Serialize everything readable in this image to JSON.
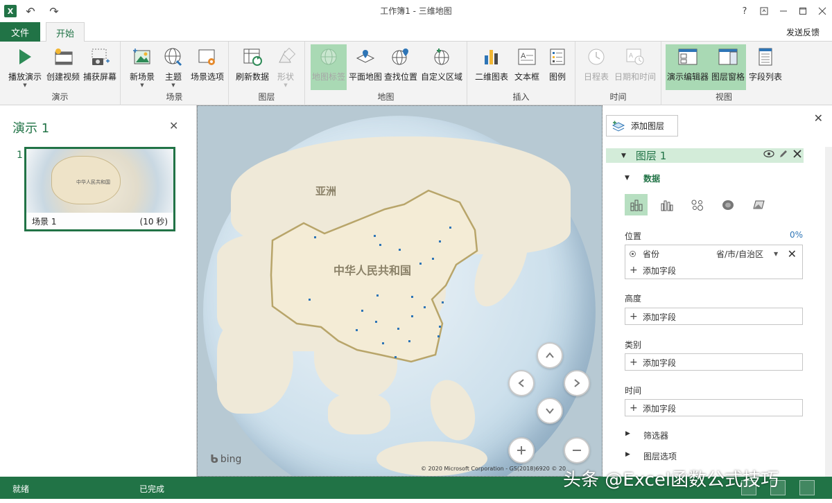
{
  "window": {
    "title": "工作簿1 - 三维地图",
    "help": "?",
    "logo_letter": "X"
  },
  "tabs": {
    "file": "文件",
    "home": "开始",
    "feedback": "发送反馈"
  },
  "ribbon": {
    "groups": {
      "presentation": "演示",
      "scene": "场景",
      "layer": "图层",
      "map": "地图",
      "insert": "插入",
      "time": "时间",
      "view": "视图"
    },
    "buttons": {
      "play": "播放演示",
      "create_video": "创建视频",
      "capture_screen": "捕获屏幕",
      "new_scene": "新场景",
      "theme": "主题",
      "scene_options": "场景选项",
      "refresh_data": "刷新数据",
      "shapes": "形状",
      "map_labels": "地图标签",
      "flat_map": "平面地图",
      "find_location": "查找位置",
      "custom_regions": "自定义区域",
      "chart_2d": "二维图表",
      "text_box": "文本框",
      "legend": "图例",
      "timeline": "日程表",
      "date_time": "日期和时间",
      "tour_editor": "演示编辑器",
      "layer_pane": "图层窗格",
      "field_list": "字段列表"
    }
  },
  "left_pane": {
    "title": "演示 1",
    "scene_number": "1",
    "scene_name": "场景 1",
    "scene_duration": "(10 秒)",
    "thumb_label": "中华人民共和国"
  },
  "map": {
    "label_asia": "亚洲",
    "label_china": "中华人民共和国",
    "bing": "bing",
    "copyright": "© 2020 Microsoft Corporation - GS(2018)6920 © 20"
  },
  "right_pane": {
    "add_layer": "添加图层",
    "layer_name": "图层 1",
    "data_section": "数据",
    "location_label": "位置",
    "location_pct": "0%",
    "location_field": "省份",
    "location_field_type": "省/市/自治区",
    "add_field": "添加字段",
    "height_label": "高度",
    "category_label": "类别",
    "time_label": "时间",
    "filters": "筛选器",
    "layer_options": "图层选项"
  },
  "status": {
    "ready": "就绪",
    "done": "已完成",
    "watermark": "头条 @Excel函数公式技巧"
  },
  "colors": {
    "accent": "#217346",
    "active_button": "#a9d9b4",
    "layer_header": "#d3ecd9"
  }
}
